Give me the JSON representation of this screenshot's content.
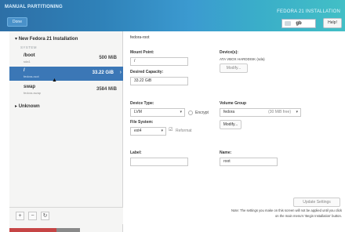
{
  "header": {
    "title": "MANUAL PARTITIONING",
    "done_label": "Done",
    "distro_title": "FEDORA 21 INSTALLATION",
    "keyboard_layout": "gb",
    "help_label": "Help!"
  },
  "left": {
    "installation_title": "New Fedora 21 Installation",
    "system_label": "SYSTEM",
    "partitions": [
      {
        "name": "/boot",
        "device": "sda1",
        "size": "500 MiB"
      },
      {
        "name": "/",
        "device": "fedora-root",
        "size": "33.22 GiB"
      },
      {
        "name": "swap",
        "device": "fedora-swap",
        "size": "3584 MiB"
      }
    ],
    "unknown_label": "Unknown",
    "toolbar": {
      "add": "+",
      "remove": "−",
      "refresh": "↻"
    }
  },
  "details": {
    "device_path": "fedora-root",
    "mount_point_label": "Mount Point:",
    "mount_point_value": "/",
    "desired_capacity_label": "Desired Capacity:",
    "desired_capacity_value": "33.22 GiB",
    "devices_label": "Device(s):",
    "devices_value": "ATA VBOX HARDDISK (sda)",
    "modify_label": "Modify...",
    "device_type_label": "Device Type:",
    "device_type_value": "LVM",
    "encrypt_label": "Encrypt",
    "volume_group_label": "Volume Group",
    "volume_group_value": "fedora",
    "volume_group_free": "(30 MiB free)",
    "vg_modify_label": "Modify...",
    "file_system_label": "File System:",
    "file_system_value": "ext4",
    "reformat_label": "Reformat",
    "label_label": "Label:",
    "label_value": "",
    "name_label": "Name:",
    "name_value": "root",
    "update_label": "Update Settings",
    "note": "Note:  The settings you make on this screen will not be applied until you click on the main menu's 'Begin Installation' button."
  },
  "colors": {
    "header_start": "#2d6fa6",
    "header_end": "#42bfc6",
    "selection": "#3b77b6"
  }
}
